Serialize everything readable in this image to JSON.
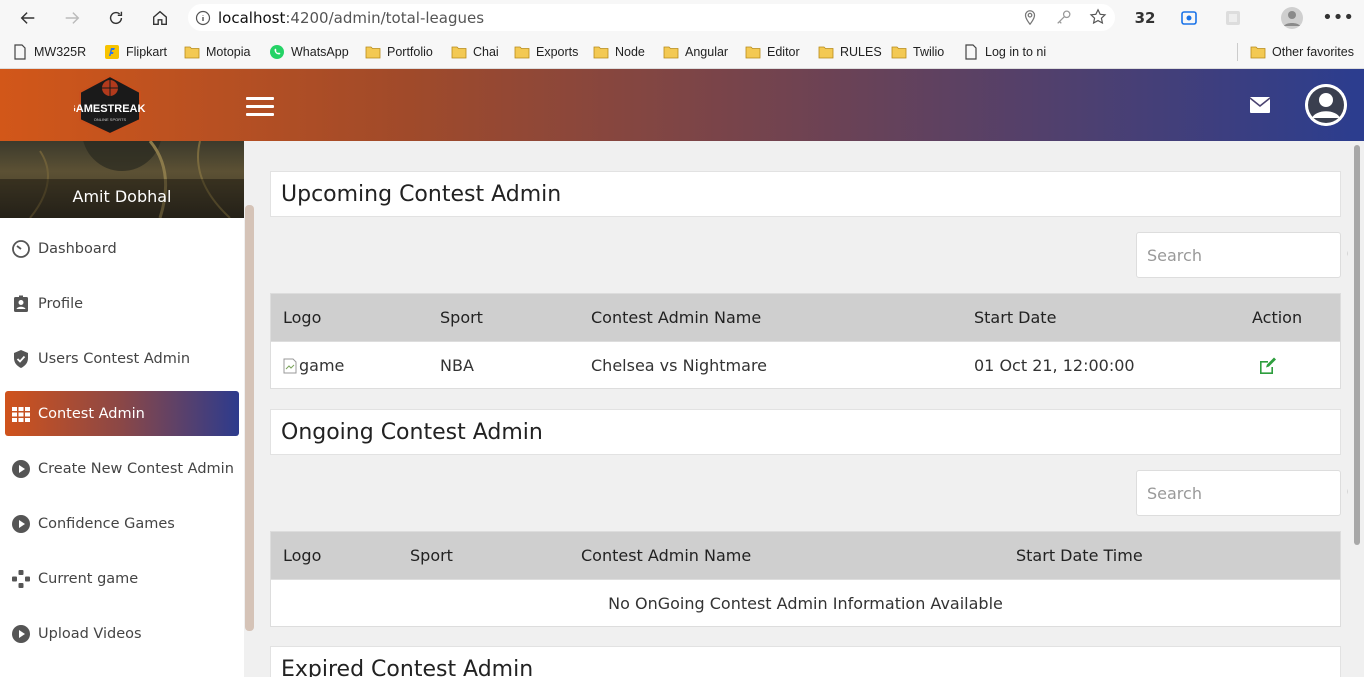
{
  "browser": {
    "url_host": "localhost",
    "url_path": ":4200/admin/total-leagues",
    "extension_count": "32",
    "bookmarks": [
      {
        "label": "MW325R",
        "icon": "page-icon"
      },
      {
        "label": "Flipkart",
        "icon": "flipkart-icon"
      },
      {
        "label": "Motopia",
        "icon": "folder-icon"
      },
      {
        "label": "WhatsApp",
        "icon": "whatsapp-icon"
      },
      {
        "label": "Portfolio",
        "icon": "folder-icon"
      },
      {
        "label": "Chai",
        "icon": "folder-icon"
      },
      {
        "label": "Exports",
        "icon": "folder-icon"
      },
      {
        "label": "Node",
        "icon": "folder-icon"
      },
      {
        "label": "Angular",
        "icon": "folder-icon"
      },
      {
        "label": "Editor",
        "icon": "folder-icon"
      },
      {
        "label": "RULES",
        "icon": "folder-icon"
      },
      {
        "label": "Twilio",
        "icon": "folder-icon"
      },
      {
        "label": "Log in to ni",
        "icon": "page-icon"
      },
      {
        "label": "Other favorites",
        "icon": "folder-icon"
      }
    ]
  },
  "header": {
    "logo_text": "GAMESTREAKS",
    "logo_subtext": "ONLINE SPORTS"
  },
  "sidebar": {
    "user_name": "Amit Dobhal",
    "items": [
      {
        "label": "Dashboard",
        "icon": "dashboard-icon"
      },
      {
        "label": "Profile",
        "icon": "profile-icon"
      },
      {
        "label": "Users Contest Admin",
        "icon": "shield-check-icon"
      },
      {
        "label": "Contest Admin",
        "icon": "grid-icon",
        "active": true
      },
      {
        "label": "Create New Contest Admin",
        "icon": "play-circle-icon"
      },
      {
        "label": "Confidence Games",
        "icon": "play-circle-icon"
      },
      {
        "label": "Current game",
        "icon": "gamepad-icon"
      },
      {
        "label": "Upload Videos",
        "icon": "play-circle-icon"
      }
    ]
  },
  "upcoming": {
    "title": "Upcoming Contest Admin",
    "search_placeholder": "Search",
    "columns": [
      "Logo",
      "Sport",
      "Contest Admin Name",
      "Start Date",
      "Action"
    ],
    "rows": [
      {
        "logo_alt": "game",
        "sport": "NBA",
        "name": "Chelsea vs Nightmare",
        "start_date": "01 Oct 21, 12:00:00",
        "action_icon": "edit-icon"
      }
    ]
  },
  "ongoing": {
    "title": "Ongoing Contest Admin",
    "search_placeholder": "Search",
    "columns": [
      "Logo",
      "Sport",
      "Contest Admin Name",
      "Start Date Time"
    ],
    "empty_message": "No OnGoing Contest Admin Information Available"
  },
  "expired": {
    "title": "Expired Contest Admin"
  },
  "colors": {
    "accent_orange": "#d25719",
    "accent_blue": "#2b3d8f",
    "edit_green": "#2e9e3e"
  }
}
